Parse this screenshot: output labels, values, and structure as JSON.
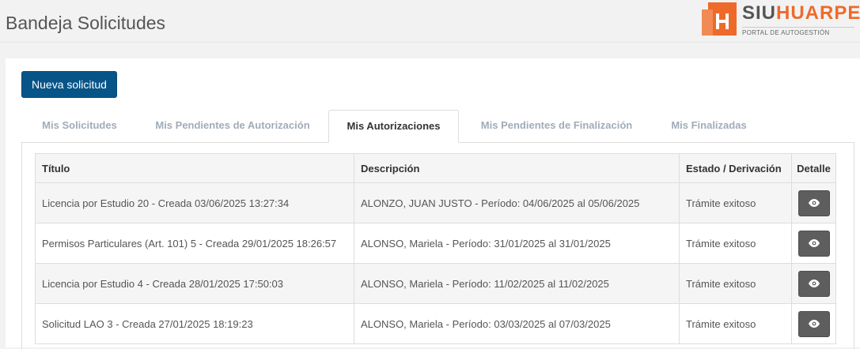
{
  "header": {
    "title": "Bandeja Solicitudes",
    "logo_siu": "SIU",
    "logo_huarpe": "HUARPE",
    "logo_subtitle": "PORTAL DE AUTOGESTIÓN"
  },
  "actions": {
    "new_request": "Nueva solicitud"
  },
  "tabs": [
    {
      "label": "Mis Solicitudes",
      "active": false
    },
    {
      "label": "Mis Pendientes de Autorización",
      "active": false
    },
    {
      "label": "Mis Autorizaciones",
      "active": true
    },
    {
      "label": "Mis Pendientes de Finalización",
      "active": false
    },
    {
      "label": "Mis Finalizadas",
      "active": false
    }
  ],
  "table": {
    "headers": {
      "titulo": "Título",
      "descripcion": "Descripción",
      "estado": "Estado / Derivación",
      "detalle": "Detalle"
    },
    "rows": [
      {
        "titulo": "Licencia por Estudio 20 - Creada 03/06/2025 13:27:34",
        "descripcion": "ALONZO, JUAN JUSTO - Período: 04/06/2025 al 05/06/2025",
        "estado": "Trámite exitoso"
      },
      {
        "titulo": "Permisos Particulares (Art. 101) 5 - Creada 29/01/2025 18:26:57",
        "descripcion": "ALONSO, Mariela - Período: 31/01/2025 al 31/01/2025",
        "estado": "Trámite exitoso"
      },
      {
        "titulo": "Licencia por Estudio 4 - Creada 28/01/2025 17:50:03",
        "descripcion": "ALONSO, Mariela - Período: 11/02/2025 al 11/02/2025",
        "estado": "Trámite exitoso"
      },
      {
        "titulo": "Solicitud LAO 3 - Creada 27/01/2025 18:19:23",
        "descripcion": "ALONSO, Mariela - Período: 03/03/2025 al 07/03/2025",
        "estado": "Trámite exitoso"
      }
    ]
  },
  "icons": {
    "detail_button": "eye-icon",
    "logo": "siu-huarpe-logo-icon"
  },
  "colors": {
    "primary": "#075488",
    "logo_orange": "#ee6a2a",
    "detail_button": "#5e5e5e"
  }
}
